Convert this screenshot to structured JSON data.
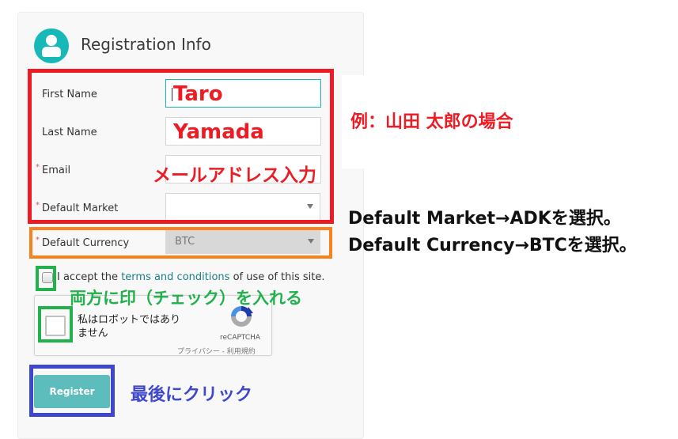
{
  "header": {
    "title": "Registration Info",
    "icon": "user-avatar-icon"
  },
  "form": {
    "first_name": {
      "label": "First Name",
      "value": "Taro",
      "required": false
    },
    "last_name": {
      "label": "Last Name",
      "value": "Yamada",
      "required": false
    },
    "email": {
      "label": "Email",
      "value": "",
      "required": true,
      "required_mark": "*"
    },
    "default_market": {
      "label": "Default Market",
      "value": "",
      "required": true,
      "required_mark": "*"
    },
    "default_currency": {
      "label": "Default Currency",
      "value": "BTC",
      "required": true,
      "required_mark": "*",
      "disabled": true
    },
    "terms": {
      "prefix": "I accept the ",
      "link": "terms and conditions",
      "suffix": " of use of this site.",
      "checked": false
    },
    "recaptcha": {
      "label_line1": "私はロボットではあり",
      "label_line2": "ません",
      "brand": "reCAPTCHA",
      "links": "プライバシー - 利用規約",
      "checked": false
    },
    "register_label": "Register"
  },
  "annotations": {
    "example": "例：山田 太郎の場合",
    "email_hint": "メールアドレス入力",
    "market_hint": "Default Market→ADKを選択。",
    "currency_hint": "Default Currency→BTCを選択。",
    "check_hint": "両方に印（チェック）を入れる",
    "click_hint": "最後にクリック",
    "colors": {
      "red": "#ed1c24",
      "orange": "#f7821e",
      "green": "#22b14c",
      "blue": "#3f48cc",
      "teal": "#17b8b8"
    }
  }
}
